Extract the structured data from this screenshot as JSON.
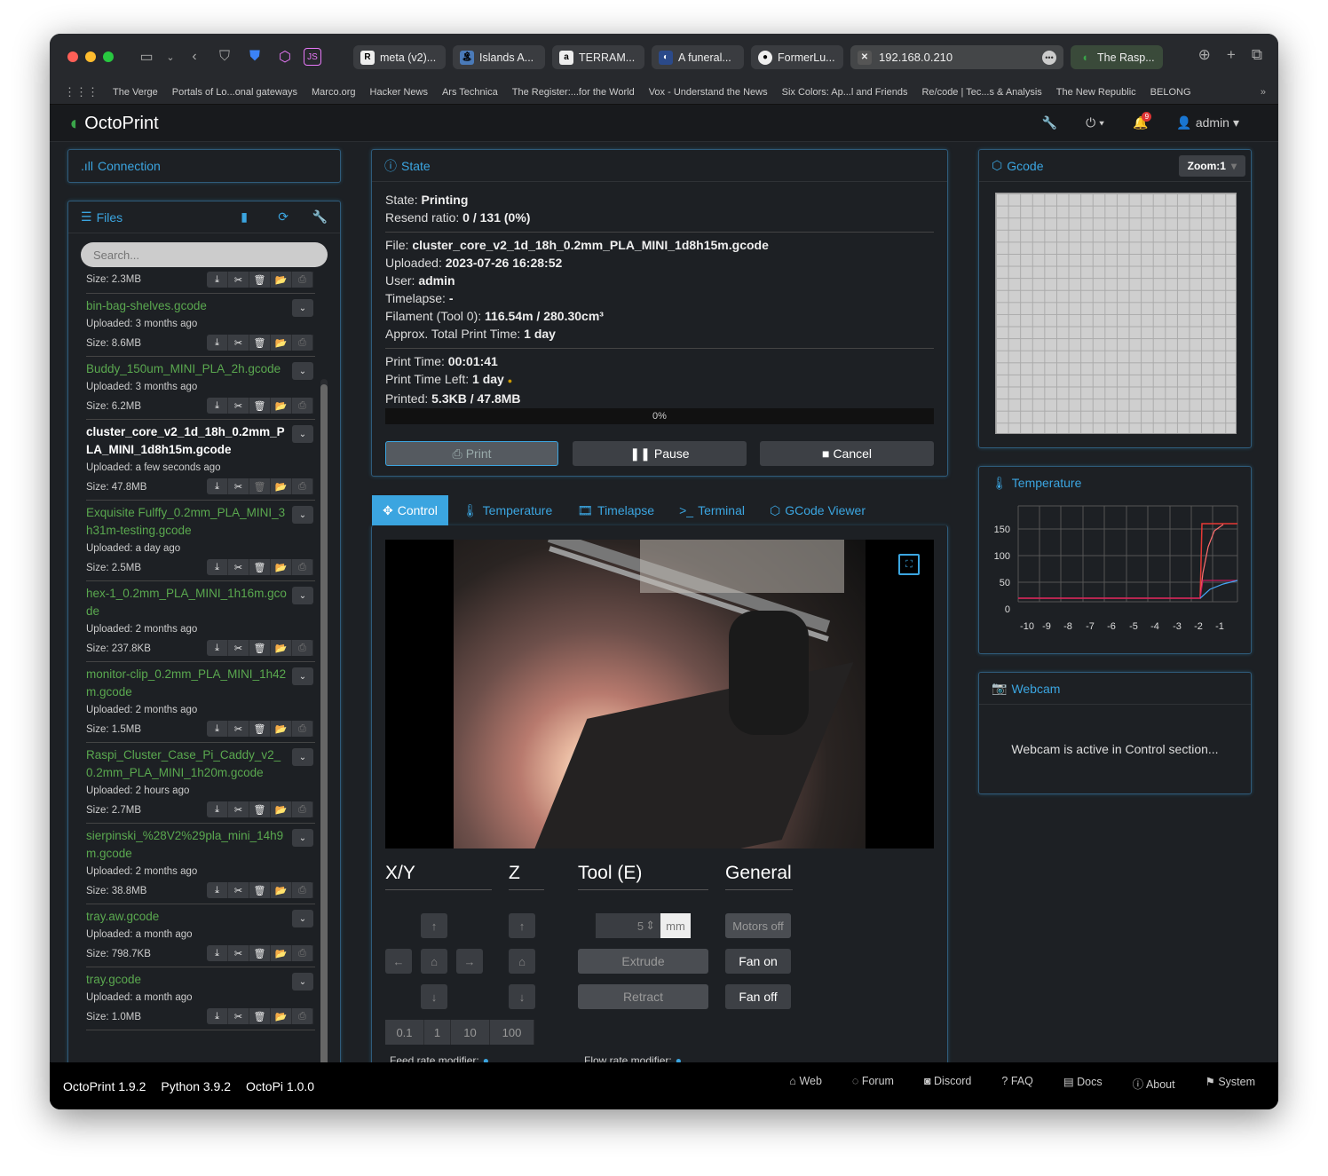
{
  "browser": {
    "tabs": [
      {
        "label": "meta (v2)...",
        "icon": "R"
      },
      {
        "label": "Islands A...",
        "icon": "🏝"
      },
      {
        "label": "TERRAM...",
        "icon": "a"
      },
      {
        "label": "A funeral...",
        "icon": "◐"
      },
      {
        "label": "FormerLu...",
        "icon": "●"
      }
    ],
    "address": "192.168.0.210",
    "last_tab": "The Rasp...",
    "bookmarks": [
      "The Verge",
      "Portals of Lo...onal gateways",
      "Marco.org",
      "Hacker News",
      "Ars Technica",
      "The Register:...for the World",
      "Vox - Understand the News",
      "Six Colors: Ap...l and Friends",
      "Re/code | Tec...s & Analysis",
      "The New Republic",
      "BELONG"
    ]
  },
  "navbar": {
    "brand": "OctoPrint",
    "user": "admin",
    "notif_count": "9"
  },
  "connection": {
    "title": "Connection"
  },
  "files": {
    "title": "Files",
    "search_placeholder": "Search...",
    "first_size": "Size: 2.3MB",
    "items": [
      {
        "name": "bin-bag-shelves.gcode",
        "uploaded": "Uploaded: 3 months ago",
        "size": "Size: 8.6MB"
      },
      {
        "name": "Buddy_150um_MINI_PLA_2h.gcode",
        "uploaded": "Uploaded: 3 months ago",
        "size": "Size: 6.2MB"
      },
      {
        "name": "cluster_core_v2_1d_18h_0.2mm_PLA_MINI_1d8h15m.gcode",
        "uploaded": "Uploaded: a few seconds ago",
        "size": "Size: 47.8MB"
      },
      {
        "name": "Exquisite Fulffy_0.2mm_PLA_MINI_3h31m-testing.gcode",
        "uploaded": "Uploaded: a day ago",
        "size": "Size: 2.5MB"
      },
      {
        "name": "hex-1_0.2mm_PLA_MINI_1h16m.gcode",
        "uploaded": "Uploaded: 2 months ago",
        "size": "Size: 237.8KB"
      },
      {
        "name": "monitor-clip_0.2mm_PLA_MINI_1h42m.gcode",
        "uploaded": "Uploaded: 2 months ago",
        "size": "Size: 1.5MB"
      },
      {
        "name": "Raspi_Cluster_Case_Pi_Caddy_v2_0.2mm_PLA_MINI_1h20m.gcode",
        "uploaded": "Uploaded: 2 hours ago",
        "size": "Size: 2.7MB"
      },
      {
        "name": "sierpinski_%28V2%29pla_mini_14h9m.gcode",
        "uploaded": "Uploaded: 2 months ago",
        "size": "Size: 38.8MB"
      },
      {
        "name": "tray.aw.gcode",
        "uploaded": "Uploaded: a month ago",
        "size": "Size: 798.7KB"
      },
      {
        "name": "tray.gcode",
        "uploaded": "Uploaded: a month ago",
        "size": "Size: 1.0MB"
      }
    ]
  },
  "state": {
    "title": "State",
    "state_label": "State:",
    "state_value": "Printing",
    "resend_label": "Resend ratio:",
    "resend_value": "0 / 131 (0%)",
    "file_label": "File:",
    "file_value": "cluster_core_v2_1d_18h_0.2mm_PLA_MINI_1d8h15m.gcode",
    "uploaded_label": "Uploaded:",
    "uploaded_value": "2023-07-26 16:28:52",
    "user_label": "User:",
    "user_value": "admin",
    "timelapse_label": "Timelapse:",
    "timelapse_value": "-",
    "filament_label": "Filament (Tool 0):",
    "filament_value": "116.54m / 280.30cm³",
    "approx_label": "Approx. Total Print Time:",
    "approx_value": "1 day",
    "printtime_label": "Print Time:",
    "printtime_value": "00:01:41",
    "timeleft_label": "Print Time Left:",
    "timeleft_value": "1 day",
    "printed_label": "Printed:",
    "printed_value": "5.3KB / 47.8MB",
    "progress_text": "0%",
    "progress": 0,
    "print_btn": "Print",
    "pause_btn": "Pause",
    "cancel_btn": "Cancel"
  },
  "control_tabs": [
    "Control",
    "Temperature",
    "Timelapse",
    "Terminal",
    "GCode Viewer"
  ],
  "control": {
    "xy": "X/Y",
    "z": "Z",
    "tool": "Tool (E)",
    "general": "General",
    "extrude_amount": "5",
    "unit": "mm",
    "extrude": "Extrude",
    "retract": "Retract",
    "motors_off": "Motors off",
    "fan_on": "Fan on",
    "fan_off": "Fan off",
    "steps": [
      "0.1",
      "1",
      "10",
      "100"
    ],
    "feed_rate": "Feed rate modifier:",
    "flow_rate": "Flow rate modifier:"
  },
  "gcode": {
    "title": "Gcode",
    "zoom": "Zoom:1"
  },
  "temperature": {
    "title": "Temperature",
    "y_ticks": [
      "150",
      "100",
      "50",
      "0"
    ],
    "x_ticks": [
      "-10",
      "-9",
      "-8",
      "-7",
      "-6",
      "-5",
      "-4",
      "-3",
      "-2",
      "-1"
    ]
  },
  "webcam": {
    "title": "Webcam",
    "message": "Webcam is active in Control section..."
  },
  "footer": {
    "versions": [
      "OctoPrint 1.9.2",
      "Python 3.9.2",
      "OctoPi 1.0.0"
    ],
    "links": [
      "Web",
      "Forum",
      "Discord",
      "FAQ",
      "Docs",
      "About",
      "System"
    ]
  },
  "colors": {
    "accent": "#3ba5e0",
    "file_green": "#5aa84f",
    "bg": "#1d2024"
  }
}
